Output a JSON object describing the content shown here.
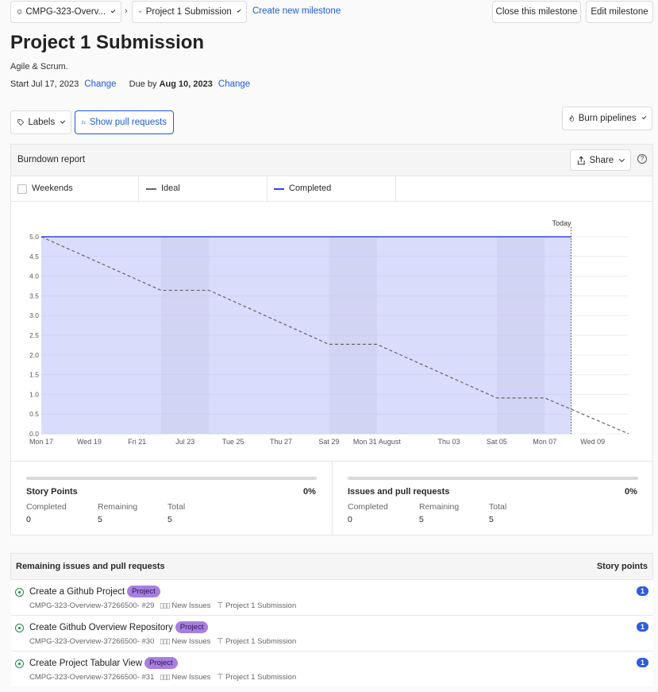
{
  "topbar": {
    "project_label": "CMPG-323-Overv...",
    "milestone_label": "Project 1 Submission",
    "create_link": "Create new milestone",
    "close_button": "Close this milestone",
    "edit_button": "Edit milestone"
  },
  "milestone": {
    "title": "Project 1 Submission",
    "description": "Agile & Scrum.",
    "start_prefix": "Start",
    "start_date": "Jul 17, 2023",
    "due_prefix": "Due by",
    "due_date": "Aug 10, 2023",
    "change_label": "Change"
  },
  "filters": {
    "labels_button": "Labels",
    "pull_requests_button": "Show pull requests",
    "burn_button": "Burn pipelines"
  },
  "report": {
    "title": "Burndown report",
    "share_button": "Share",
    "legend": {
      "weekends": "Weekends",
      "ideal": "Ideal",
      "completed": "Completed"
    },
    "today_label": "Today"
  },
  "colors": {
    "completed_line": "#2f46e8",
    "completed_fill": "#dadcfb",
    "weekend_band": "#cfd2f2",
    "link": "#1f5bd9",
    "badge": "#a87fdf",
    "count_badge": "#2e5ddb"
  },
  "chart_data": {
    "type": "line",
    "y_ticks": [
      "5.0",
      "4.5",
      "4.0",
      "3.5",
      "3.0",
      "2.5",
      "2.0",
      "1.5",
      "1.0",
      "0.5",
      "0.0"
    ],
    "ylim": [
      0,
      5
    ],
    "x_tick_labels": [
      "Mon 17",
      "Wed 19",
      "Fri 21",
      "Jul 23",
      "Tue 25",
      "Thu 27",
      "Sat 29",
      "Mon 31 August",
      "Thu 03",
      "Sat 05",
      "Mon 07",
      "Wed 09"
    ],
    "x_tick_days": [
      0,
      2,
      4,
      6,
      8,
      10,
      12,
      14,
      17,
      19,
      21,
      23
    ],
    "x_range_days": [
      0,
      24.5
    ],
    "weekend_day_ranges": [
      [
        5,
        7
      ],
      [
        12,
        14
      ],
      [
        19,
        21
      ]
    ],
    "today_day": 22.1,
    "series": [
      {
        "name": "Ideal",
        "style": "dashed",
        "points": [
          [
            0,
            5.0
          ],
          [
            5,
            3.64
          ],
          [
            7,
            3.64
          ],
          [
            12,
            2.27
          ],
          [
            14,
            2.27
          ],
          [
            19,
            0.91
          ],
          [
            21,
            0.91
          ],
          [
            24.5,
            0.0
          ]
        ]
      },
      {
        "name": "Completed",
        "style": "solid",
        "points": [
          [
            0,
            5.0
          ],
          [
            22.1,
            5.0
          ]
        ]
      }
    ]
  },
  "summary": {
    "story_points": {
      "title": "Story Points",
      "percent": "0%",
      "completed_label": "Completed",
      "completed": "0",
      "remaining_label": "Remaining",
      "remaining": "5",
      "total_label": "Total",
      "total": "5"
    },
    "issues": {
      "title": "Issues and pull requests",
      "percent": "0%",
      "completed_label": "Completed",
      "completed": "0",
      "remaining_label": "Remaining",
      "remaining": "5",
      "total_label": "Total",
      "total": "5"
    }
  },
  "remaining": {
    "header": "Remaining issues and pull requests",
    "points_header": "Story points",
    "items": [
      {
        "title": "Create a Github Project",
        "label": "Project",
        "repo": "CMPG-323-Overview-37266500- #29",
        "pipeline": "New Issues",
        "milestone": "Project 1 Submission",
        "points": "1"
      },
      {
        "title": "Create Github Overview Repository",
        "label": "Project",
        "repo": "CMPG-323-Overview-37266500- #30",
        "pipeline": "New Issues",
        "milestone": "Project 1 Submission",
        "points": "1"
      },
      {
        "title": "Create Project Tabular View",
        "label": "Project",
        "repo": "CMPG-323-Overview-37266500- #31",
        "pipeline": "New Issues",
        "milestone": "Project 1 Submission",
        "points": "1"
      }
    ]
  }
}
